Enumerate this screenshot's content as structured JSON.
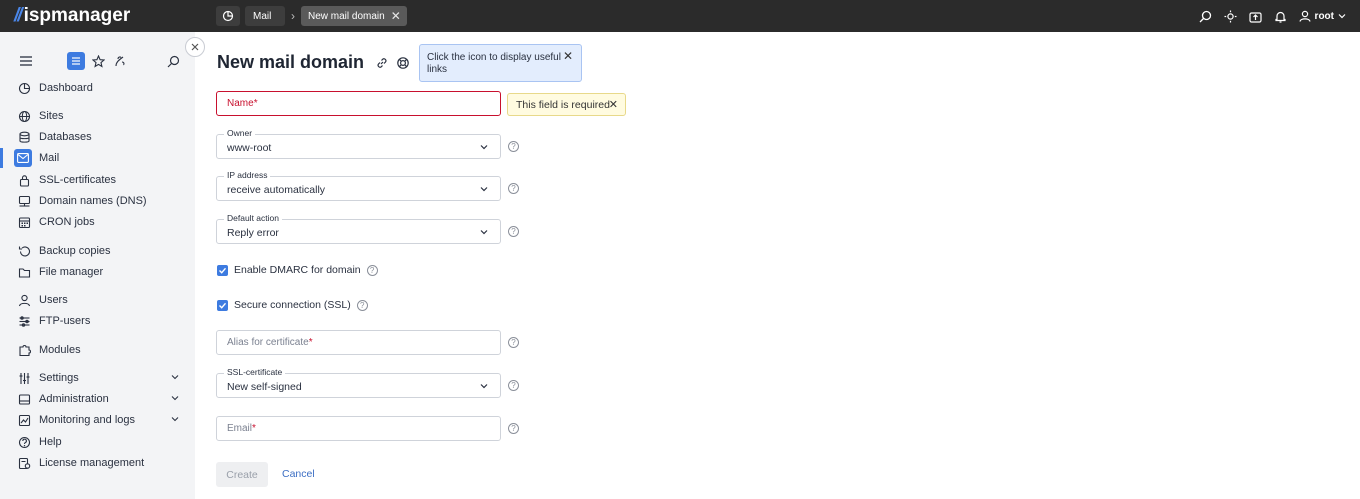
{
  "app": {
    "logo_mark": "//",
    "logo_text": "ispmanager"
  },
  "breadcrumbs": {
    "mail": "Mail",
    "current": "New mail domain"
  },
  "user": {
    "name": "root"
  },
  "sidebar": {
    "items": [
      {
        "label": "Dashboard",
        "icon": "dashboard-icon"
      },
      {
        "label": "Sites",
        "icon": "globe-icon"
      },
      {
        "label": "Databases",
        "icon": "database-icon"
      },
      {
        "label": "Mail",
        "icon": "mail-icon",
        "active": true
      },
      {
        "label": "SSL-certificates",
        "icon": "lock-icon"
      },
      {
        "label": "Domain names (DNS)",
        "icon": "dns-icon"
      },
      {
        "label": "CRON jobs",
        "icon": "calendar-icon"
      },
      {
        "label": "Backup copies",
        "icon": "backup-icon"
      },
      {
        "label": "File manager",
        "icon": "folder-icon"
      },
      {
        "label": "Users",
        "icon": "user-icon"
      },
      {
        "label": "FTP-users",
        "icon": "ftp-icon"
      },
      {
        "label": "Modules",
        "icon": "puzzle-icon"
      },
      {
        "label": "Settings",
        "icon": "sliders-icon",
        "expandable": true
      },
      {
        "label": "Administration",
        "icon": "admin-icon",
        "expandable": true
      },
      {
        "label": "Monitoring and logs",
        "icon": "chart-icon",
        "expandable": true
      },
      {
        "label": "Help",
        "icon": "help-icon"
      },
      {
        "label": "License management",
        "icon": "license-icon"
      }
    ]
  },
  "page": {
    "title": "New mail domain",
    "links_tip": "Click the icon to display useful links",
    "error_tip": "This field is required"
  },
  "form": {
    "name": {
      "placeholder": "Name",
      "required_mark": "*"
    },
    "owner": {
      "label": "Owner",
      "value": "www-root"
    },
    "ip": {
      "label": "IP address",
      "value": "receive automatically"
    },
    "default_action": {
      "label": "Default action",
      "value": "Reply error"
    },
    "dmarc": {
      "label": "Enable DMARC for domain",
      "checked": true
    },
    "ssl": {
      "label": "Secure connection (SSL)",
      "checked": true
    },
    "alias": {
      "placeholder": "Alias for certificate",
      "required_mark": "*"
    },
    "ssl_cert": {
      "label": "SSL-certificate",
      "value": "New self-signed"
    },
    "email": {
      "placeholder": "Email",
      "required_mark": "*"
    },
    "help_glyph": "?",
    "create_label": "Create",
    "cancel_label": "Cancel"
  },
  "colors": {
    "accent": "#3d7be0",
    "error": "#c8102e",
    "topbar": "#2b2b2b"
  }
}
